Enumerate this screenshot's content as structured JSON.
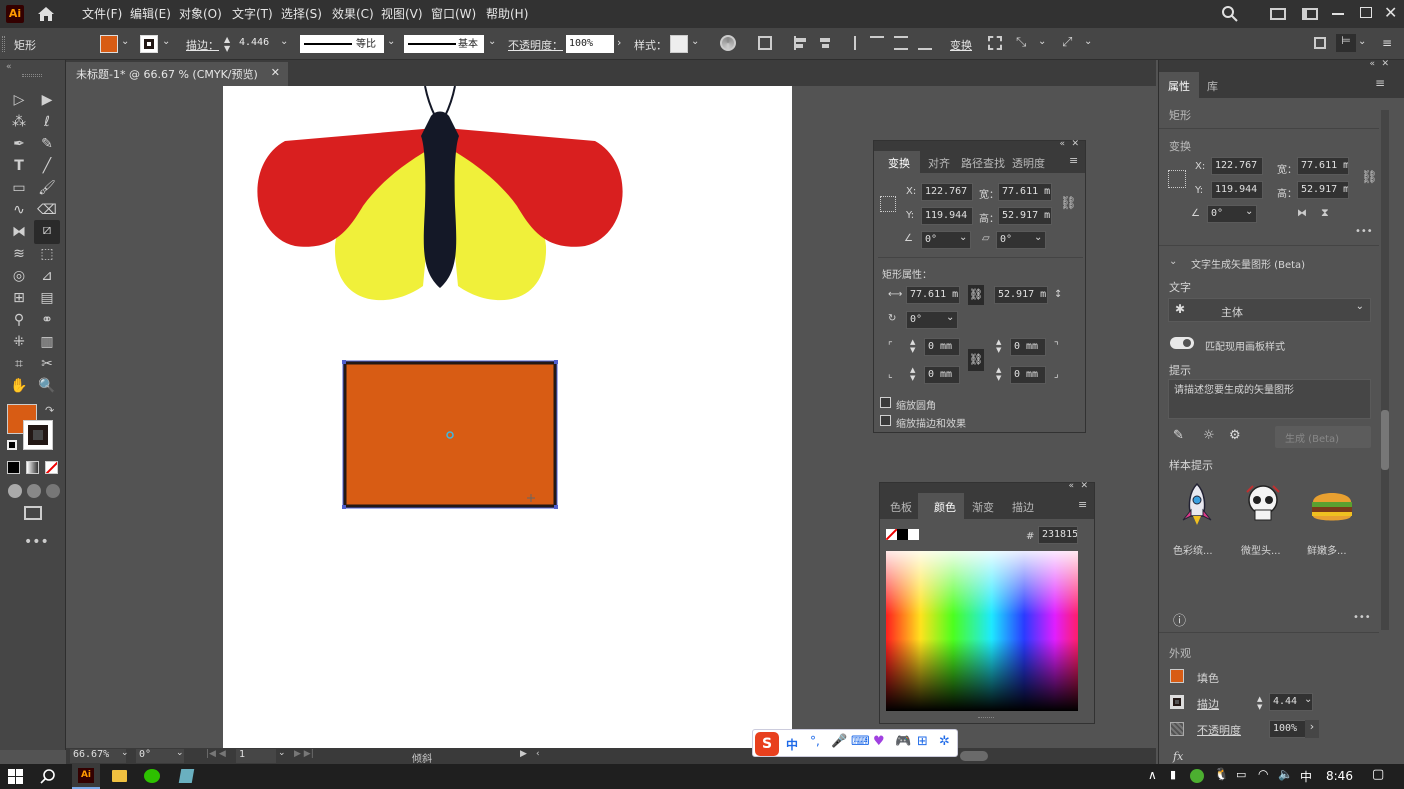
{
  "app": {
    "logo": "Ai"
  },
  "menu": [
    "文件(F)",
    "编辑(E)",
    "对象(O)",
    "文字(T)",
    "选择(S)",
    "效果(C)",
    "视图(V)",
    "窗口(W)",
    "帮助(H)"
  ],
  "control": {
    "object_type": "矩形",
    "stroke_label": "描边：",
    "stroke_value": "4.446",
    "stroke_profile": "等比",
    "brush": "基本",
    "opacity_label": "不透明度：",
    "opacity_value": "100%",
    "style_label": "样式：",
    "transform_label": "变换",
    "fill_color": "#d85c14",
    "stroke_color": "#231815"
  },
  "document": {
    "tab_title": "未标题-1* @ 66.67 % (CMYK/预览)"
  },
  "transform_panel": {
    "tabs": [
      "变换",
      "对齐",
      "路径查找",
      "透明度"
    ],
    "x_label": "X:",
    "x": "122.767",
    "y_label": "Y:",
    "y": "119.944",
    "w_label": "宽：",
    "w": "77.611 m",
    "h_label": "高：",
    "h": "52.917 m",
    "rotate": "0°",
    "shear": "0°",
    "rect_props_label": "矩形属性：",
    "rect_w": "77.611 m",
    "rect_h": "52.917 m",
    "rect_rotate": "0°",
    "corner_tl": "0 mm",
    "corner_tr": "0 mm",
    "corner_bl": "0 mm",
    "corner_br": "0 mm",
    "scale_corners": "缩放圆角",
    "scale_strokes": "缩放描边和效果"
  },
  "color_panel": {
    "tabs": [
      "色板",
      "颜色",
      "渐变",
      "描边"
    ],
    "hash": "#",
    "hex": "231815"
  },
  "properties": {
    "tabs": [
      "属性",
      "库"
    ],
    "object_type": "矩形",
    "transform_title": "变换",
    "x_label": "X:",
    "x": "122.767",
    "y_label": "Y:",
    "y": "119.944",
    "w_label": "宽：",
    "w": "77.611 m",
    "h_label": "高：",
    "h": "52.917 m",
    "rotate": "0°",
    "text_to_vector_title": "文字生成矢量图形 (Beta)",
    "subject_label": "文字",
    "subject_value": "主体",
    "match_style_label": "匹配现用画板样式",
    "prompt_label": "提示",
    "prompt_placeholder": "请描述您要生成的矢量图形",
    "generate_label": "生成 (Beta)",
    "samples_label": "样本提示",
    "samples": [
      "色彩缤...",
      "微型头...",
      "鲜嫩多..."
    ],
    "appearance_title": "外观",
    "fill_label": "填色",
    "stroke_label": "描边",
    "stroke_value": "4.44",
    "opacity_label": "不透明度",
    "opacity_value": "100%",
    "fx": "fx"
  },
  "status": {
    "zoom": "66.67%",
    "rotation": "0°",
    "artboard": "1",
    "tool": "倾斜"
  },
  "ime": {
    "lang": "中"
  },
  "taskbar": {
    "time": "8:46",
    "ime_lang": "中"
  },
  "artwork": {
    "wing_red": "#d91f1f",
    "wing_yellow": "#f0f03a",
    "body": "#141827",
    "rect_fill": "#d85c14",
    "rect_stroke": "#231815"
  }
}
